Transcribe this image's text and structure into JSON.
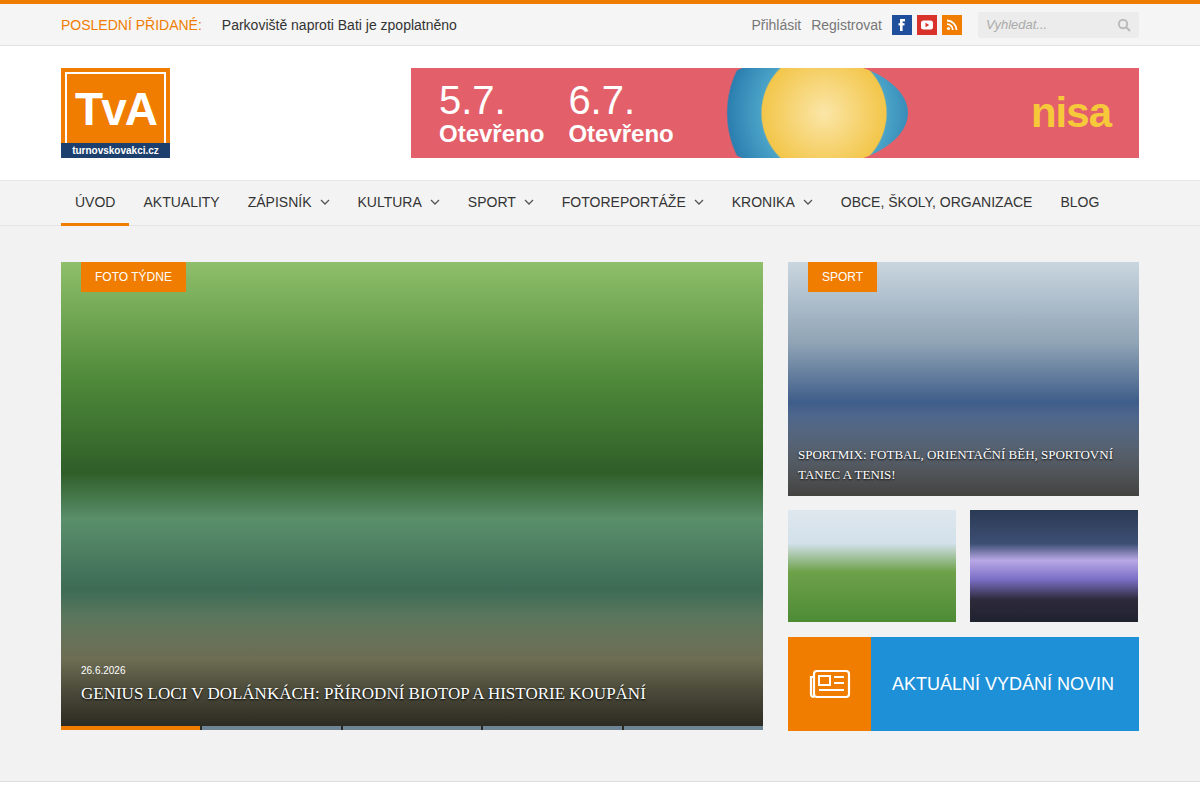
{
  "topbar": {
    "latest_label": "POSLEDNÍ PŘIDANÉ:",
    "latest_title": "Parkoviště naproti Bati je zpoplatněno",
    "links": [
      "Přihlásit",
      "Registrovat"
    ],
    "social": [
      {
        "kind": "facebook",
        "color": "#1f4e9c"
      },
      {
        "kind": "youtube",
        "color": "#d9322b"
      },
      {
        "kind": "rss",
        "color": "#f07d00"
      }
    ],
    "search": {
      "placeholder": "Vyhledat..."
    }
  },
  "logo": {
    "mark": "TvA",
    "domain": "turnovskovakci.cz"
  },
  "ad": {
    "items": [
      {
        "date": "5.7.",
        "label": "Otevřeno"
      },
      {
        "date": "6.7.",
        "label": "Otevřeno"
      }
    ],
    "brand": "nisa"
  },
  "nav": [
    {
      "label": "ÚVOD",
      "selected": true,
      "dropdown": false
    },
    {
      "label": "AKTUALITY",
      "selected": false,
      "dropdown": false
    },
    {
      "label": "ZÁPISNÍK",
      "selected": false,
      "dropdown": true
    },
    {
      "label": "KULTURA",
      "selected": false,
      "dropdown": true
    },
    {
      "label": "SPORT",
      "selected": false,
      "dropdown": true
    },
    {
      "label": "FOTOREPORTÁŽE",
      "selected": false,
      "dropdown": true
    },
    {
      "label": "KRONIKA",
      "selected": false,
      "dropdown": true
    },
    {
      "label": "OBCE, ŠKOLY, ORGANIZACE",
      "selected": false,
      "dropdown": false
    },
    {
      "label": "BLOG",
      "selected": false,
      "dropdown": false
    }
  ],
  "hero": {
    "badge": "FOTO TÝDNE",
    "date": "26.6.2026",
    "title": "GENIUS LOCI V DOLÁNKÁCH: PŘÍRODNÍ BIOTOP A HISTORIE KOUPÁNÍ",
    "slides": [
      {
        "selected": true
      },
      {
        "selected": false
      },
      {
        "selected": false
      },
      {
        "selected": false
      },
      {
        "selected": false
      }
    ]
  },
  "side_feature": {
    "badge": "SPORT",
    "title": "SPORTMIX: FOTBAL, ORIENTAČNÍ BĚH, SPORTOVNÍ TANEC A TENIS!"
  },
  "newspaper": {
    "label": "AKTUÁLNÍ VYDÁNÍ NOVIN"
  }
}
